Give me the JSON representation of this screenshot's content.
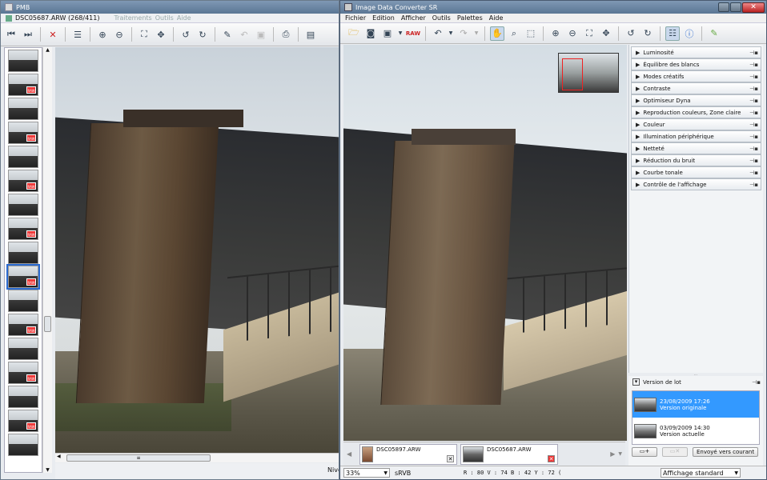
{
  "pmb": {
    "title": "PMB",
    "filename": "DSC05687.ARW (268/411)",
    "menu": [
      "Traitements",
      "Outils",
      "Aide"
    ],
    "status_right": "Nive",
    "thumbnails": [
      {
        "raw": false,
        "selected": false
      },
      {
        "raw": true,
        "selected": false
      },
      {
        "raw": false,
        "selected": false
      },
      {
        "raw": true,
        "selected": false
      },
      {
        "raw": false,
        "selected": false
      },
      {
        "raw": true,
        "selected": false
      },
      {
        "raw": false,
        "selected": false
      },
      {
        "raw": true,
        "selected": false
      },
      {
        "raw": false,
        "selected": false
      },
      {
        "raw": true,
        "selected": true
      },
      {
        "raw": false,
        "selected": false
      },
      {
        "raw": true,
        "selected": false
      },
      {
        "raw": false,
        "selected": false
      },
      {
        "raw": true,
        "selected": false
      },
      {
        "raw": false,
        "selected": false
      },
      {
        "raw": true,
        "selected": false
      },
      {
        "raw": false,
        "selected": false
      }
    ],
    "toolbar_icons": [
      "first-icon",
      "next-icon",
      "delete-icon",
      "layers-icon",
      "zoom-in-icon",
      "zoom-out-icon",
      "fit-icon",
      "move-icon",
      "rotate-left-icon",
      "rotate-right-icon",
      "palette-icon",
      "undo-icon",
      "save-icon",
      "print-icon",
      "export-icon"
    ],
    "raw_badge": "RAW"
  },
  "idc": {
    "title": "Image Data Converter SR",
    "menu": [
      "Fichier",
      "Edition",
      "Afficher",
      "Outils",
      "Palettes",
      "Aide"
    ],
    "palettes": [
      "Luminosité",
      "Équilibre des blancs",
      "Modes créatifs",
      "Contraste",
      "Optimiseur Dyna",
      "Reproduction couleurs, Zone claire",
      "Couleur",
      "Illumination périphérique",
      "Netteté",
      "Réduction du bruit",
      "Courbe tonale",
      "Contrôle de l'affichage"
    ],
    "version_panel": {
      "title": "Version de lot",
      "versions": [
        {
          "date": "23/08/2009 17:26",
          "label": "Version originale",
          "selected": true
        },
        {
          "date": "03/09/2009 14:30",
          "label": "Version actuelle",
          "selected": false
        }
      ],
      "send_button": "Envoyé vers courant"
    },
    "filmstrip": [
      {
        "name": "DSC05897.ARW"
      },
      {
        "name": "DSC05687.ARW"
      }
    ],
    "status": {
      "zoom": "33%",
      "colorspace": "sRVB",
      "readout": "R : 80  V : 74  B : 42  Y : 72  (",
      "view_mode": "Affichage standard"
    }
  },
  "colors": {
    "accent": "#3a8ee6",
    "selection": "#3399ff"
  }
}
